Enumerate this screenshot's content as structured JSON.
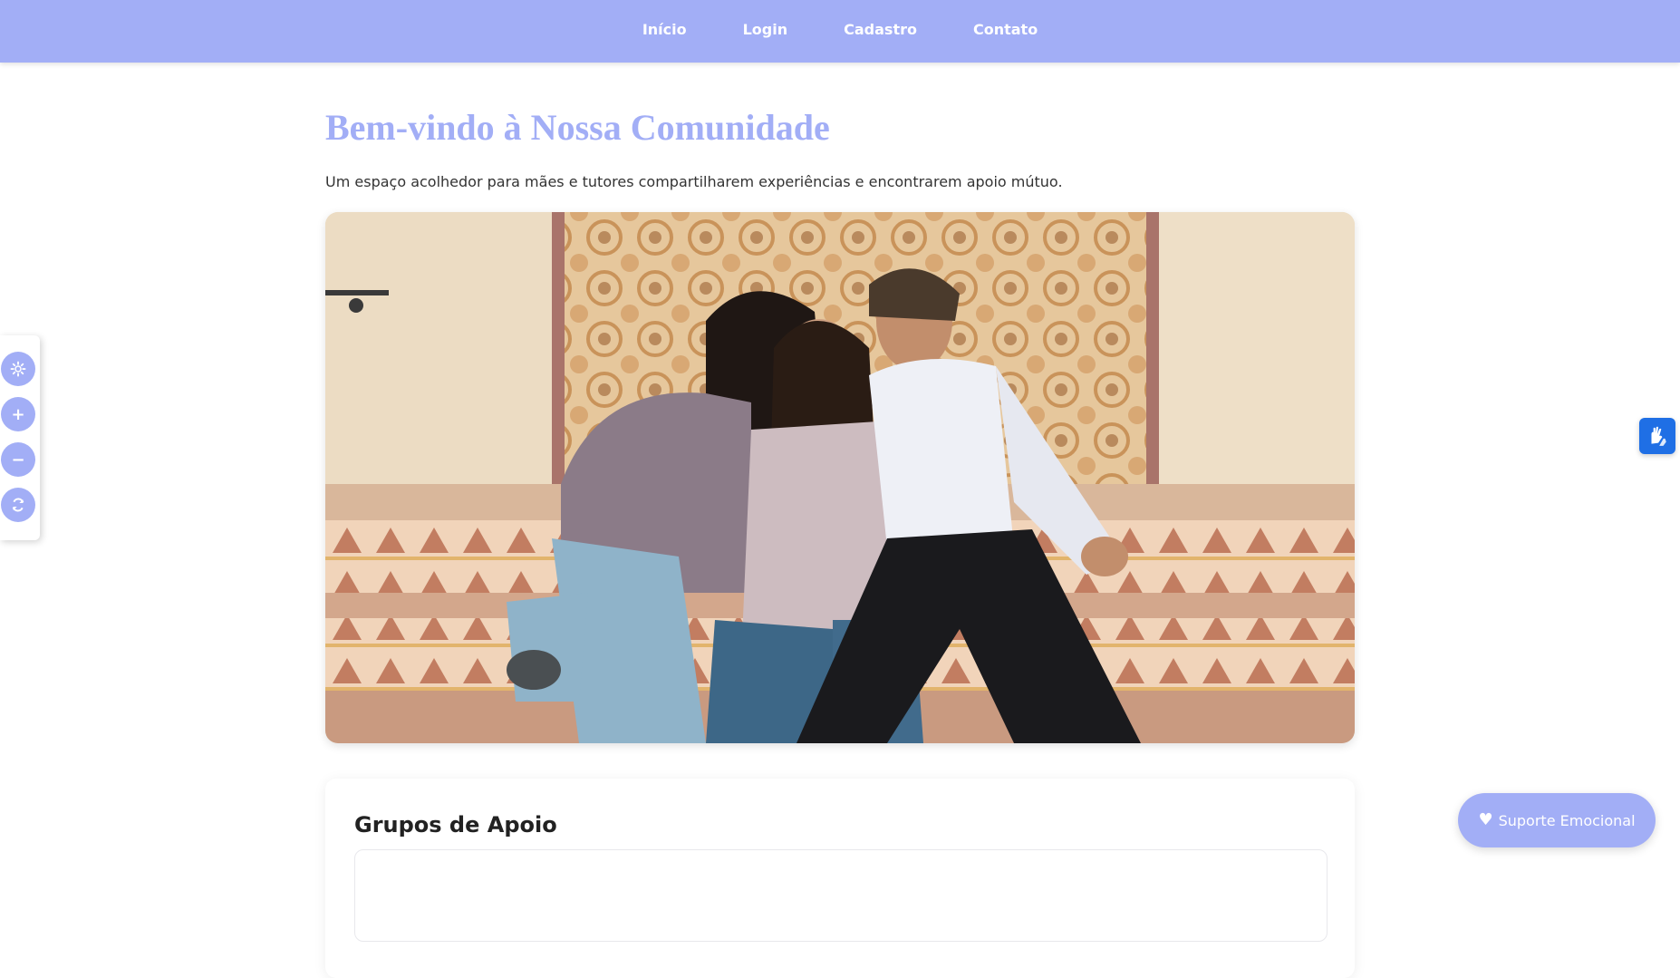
{
  "nav": {
    "items": [
      {
        "label": "Início"
      },
      {
        "label": "Login"
      },
      {
        "label": "Cadastro"
      },
      {
        "label": "Contato"
      }
    ]
  },
  "main": {
    "title": "Bem-vindo à Nossa Comunidade",
    "intro": "Um espaço acolhedor para mães e tutores compartilharem experiências e encontrarem apoio mútuo.",
    "hero_image": "photo of smiling family sitting on tiled steps",
    "section_title": "Grupos de Apoio"
  },
  "accessibility": {
    "buttons": [
      {
        "icon": "gear-icon"
      },
      {
        "icon": "plus-icon"
      },
      {
        "icon": "minus-icon"
      },
      {
        "icon": "refresh-icon"
      }
    ]
  },
  "vlibras": {
    "icon": "sign-language-icon"
  },
  "support_button": {
    "label": "Suporte Emocional",
    "icon": "heart-icon"
  },
  "colors": {
    "accent": "#a2aef6",
    "vlibras_blue": "#1f6fe5"
  }
}
